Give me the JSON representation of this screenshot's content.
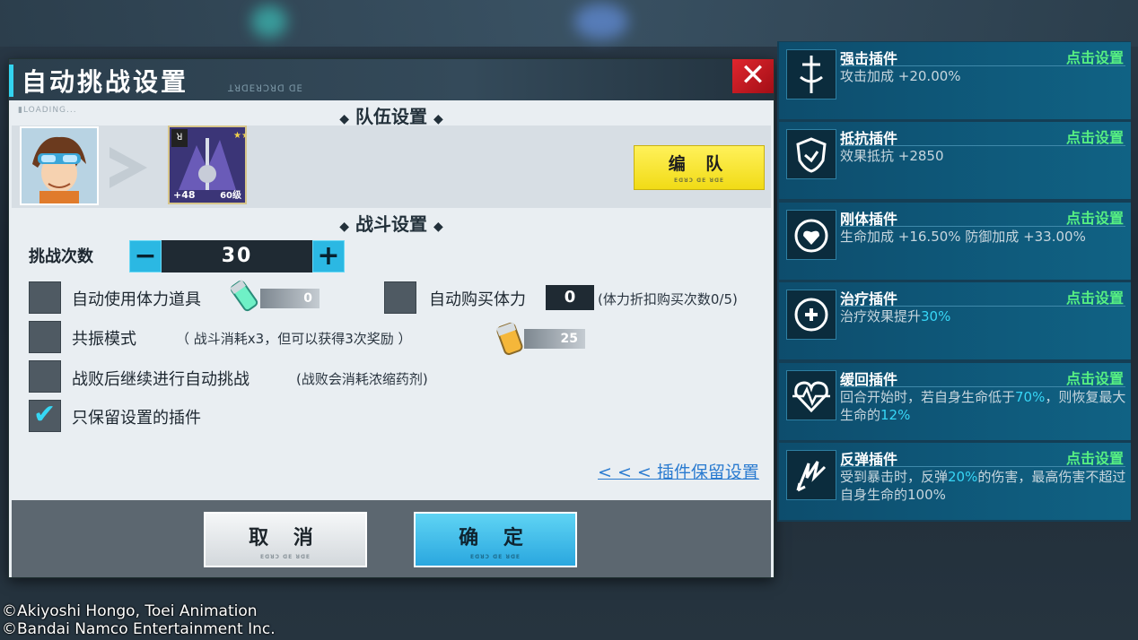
{
  "dialog": {
    "title": "自动挑战设置",
    "subtitle": "ꓕꓤꓷꓰꓤꓛꓤꓷ ꓷꓰ",
    "close_glyph": "✕",
    "loading_text": "▮LOADING...",
    "team_section": "队伍设置",
    "battle_section": "战斗设置",
    "team_button": "编 队",
    "team_button_sub": "ꓰꓷꓤꓛ ꓷꓰ ꓤꓷꓰ",
    "monster": {
      "plus": "+48",
      "level": "60级",
      "badge": "ꓤ",
      "stars": "★★★★★"
    },
    "challenge_count_label": "挑战次数",
    "challenge_count_value": "30",
    "minus": "−",
    "plus": "+",
    "options": [
      {
        "label": "自动使用体力道具",
        "checked": false
      },
      {
        "label": "自动购买体力",
        "checked": false
      },
      {
        "label": "共振模式",
        "checked": false
      },
      {
        "label": "战败后继续进行自动挑战",
        "checked": false
      },
      {
        "label": "只保留设置的插件",
        "checked": true
      }
    ],
    "stamina_item_count": "0",
    "auto_buy_count": "0",
    "auto_buy_note": "(体力折扣购买次数0/5)",
    "resonance_note": "（ 战斗消耗x3，但可以获得3次奖励 ）",
    "resonance_count": "25",
    "defeat_note": "(战败会消耗浓缩药剂)",
    "plugin_link": "< < < 插件保留设置",
    "cancel_button": "取 消",
    "ok_button": "确 定",
    "btn_sub": "ꓰꓷꓤꓛ ꓷꓰ ꓤꓷꓰ",
    "check_glyph": "✔"
  },
  "plugins": [
    {
      "name": "强击插件",
      "action": "点击设置",
      "desc_plain": "攻击加成 +20.00%",
      "icon": "sword-icon"
    },
    {
      "name": "抵抗插件",
      "action": "点击设置",
      "desc_plain": "效果抵抗 +2850",
      "icon": "shield-icon"
    },
    {
      "name": "刚体插件",
      "action": "点击设置",
      "desc_plain": "生命加成 +16.50%  防御加成 +33.00%",
      "icon": "heart-shield-icon"
    },
    {
      "name": "治疗插件",
      "action": "点击设置",
      "desc_a": "治疗效果提升",
      "desc_hl": "30%",
      "icon": "heal-icon"
    },
    {
      "name": "缓回插件",
      "action": "点击设置",
      "desc_a": "回合开始时，若自身生命低于",
      "desc_hl": "70%",
      "desc_b": "，则恢复最大生命的",
      "desc_hl2": "12%",
      "icon": "heartbeat-icon"
    },
    {
      "name": "反弹插件",
      "action": "点击设置",
      "desc_a": "受到暴击时，反弹",
      "desc_hl": "20%",
      "desc_b": "的伤害，最高伤害不超过自身生命的100%",
      "icon": "reflect-icon"
    }
  ],
  "copyright": [
    "©Akiyoshi Hongo, Toei Animation",
    "©Bandai Namco Entertainment Inc."
  ],
  "colors": {
    "accent": "#33d3f0",
    "plugin_action": "#57f082",
    "highlight": "#37d6f6",
    "close": "#e0262e",
    "team_button": "#fff15a"
  }
}
